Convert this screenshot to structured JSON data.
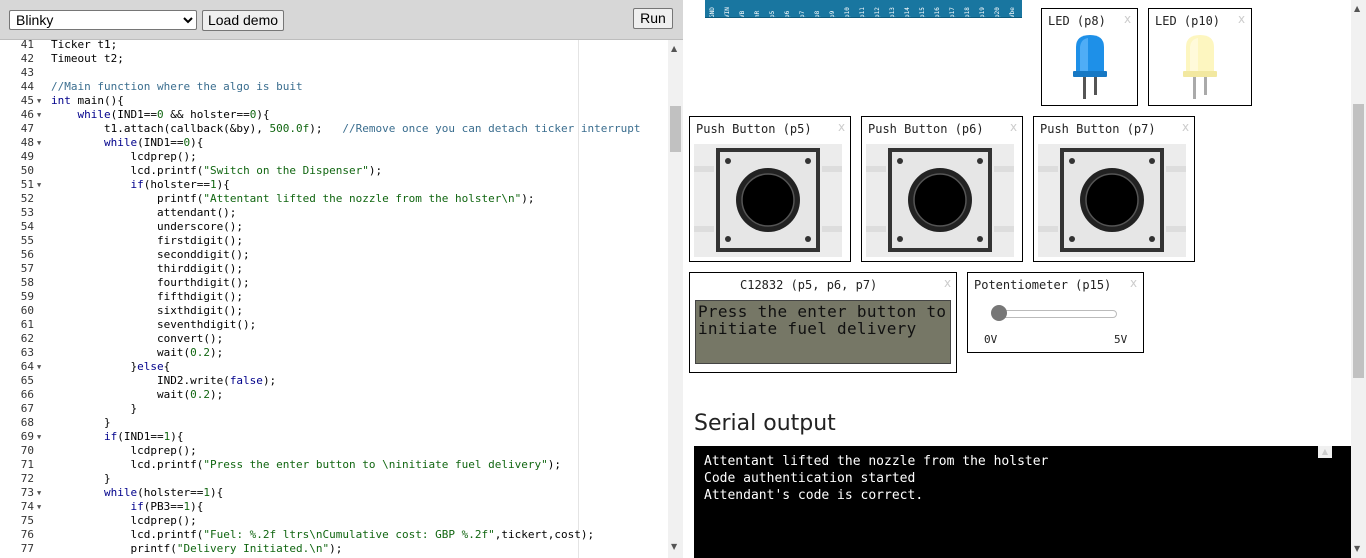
{
  "toolbar": {
    "selected_demo": "Blinky",
    "load_label": "Load demo",
    "run_label": "Run"
  },
  "editor": {
    "lines": [
      {
        "n": "41",
        "fold": false,
        "parts": [
          [
            "",
            "Ticker t1;"
          ]
        ]
      },
      {
        "n": "42",
        "fold": false,
        "parts": [
          [
            "",
            "Timeout t2;"
          ]
        ]
      },
      {
        "n": "43",
        "fold": false,
        "parts": [
          [
            "",
            ""
          ]
        ]
      },
      {
        "n": "44",
        "fold": false,
        "parts": [
          [
            "c",
            "//Main function where the algo is buit"
          ]
        ]
      },
      {
        "n": "45",
        "fold": true,
        "parts": [
          [
            "k",
            "int"
          ],
          [
            "",
            " main(){"
          ]
        ]
      },
      {
        "n": "46",
        "fold": true,
        "parts": [
          [
            "",
            "    "
          ],
          [
            "k",
            "while"
          ],
          [
            "",
            "(IND1=="
          ],
          [
            "n",
            "0"
          ],
          [
            "",
            " && holster=="
          ],
          [
            "n",
            "0"
          ],
          [
            "",
            "){"
          ]
        ]
      },
      {
        "n": "47",
        "fold": false,
        "parts": [
          [
            "",
            "        t1.attach(callback(&by), "
          ],
          [
            "n",
            "500.0f"
          ],
          [
            "",
            ");   "
          ],
          [
            "c",
            "//Remove once you can detach ticker interrupt"
          ]
        ]
      },
      {
        "n": "48",
        "fold": true,
        "parts": [
          [
            "",
            "        "
          ],
          [
            "k",
            "while"
          ],
          [
            "",
            "(IND1=="
          ],
          [
            "n",
            "0"
          ],
          [
            "",
            "){"
          ]
        ]
      },
      {
        "n": "49",
        "fold": false,
        "parts": [
          [
            "",
            "            lcdprep();"
          ]
        ]
      },
      {
        "n": "50",
        "fold": false,
        "parts": [
          [
            "",
            "            lcd.printf("
          ],
          [
            "s",
            "\"Switch on the Dispenser\""
          ],
          [
            "",
            ");"
          ]
        ]
      },
      {
        "n": "51",
        "fold": true,
        "parts": [
          [
            "",
            "            "
          ],
          [
            "k",
            "if"
          ],
          [
            "",
            "(holster=="
          ],
          [
            "n",
            "1"
          ],
          [
            "",
            "){"
          ]
        ]
      },
      {
        "n": "52",
        "fold": false,
        "parts": [
          [
            "",
            "                printf("
          ],
          [
            "s",
            "\"Attentant lifted the nozzle from the holster\\n\""
          ],
          [
            "",
            ");"
          ]
        ]
      },
      {
        "n": "53",
        "fold": false,
        "parts": [
          [
            "",
            "                attendant();"
          ]
        ]
      },
      {
        "n": "54",
        "fold": false,
        "parts": [
          [
            "",
            "                underscore();"
          ]
        ]
      },
      {
        "n": "55",
        "fold": false,
        "parts": [
          [
            "",
            "                firstdigit();"
          ]
        ]
      },
      {
        "n": "56",
        "fold": false,
        "parts": [
          [
            "",
            "                seconddigit();"
          ]
        ]
      },
      {
        "n": "57",
        "fold": false,
        "parts": [
          [
            "",
            "                thirddigit();"
          ]
        ]
      },
      {
        "n": "58",
        "fold": false,
        "parts": [
          [
            "",
            "                fourthdigit();"
          ]
        ]
      },
      {
        "n": "59",
        "fold": false,
        "parts": [
          [
            "",
            "                fifthdigit();"
          ]
        ]
      },
      {
        "n": "60",
        "fold": false,
        "parts": [
          [
            "",
            "                sixthdigit();"
          ]
        ]
      },
      {
        "n": "61",
        "fold": false,
        "parts": [
          [
            "",
            "                seventhdigit();"
          ]
        ]
      },
      {
        "n": "62",
        "fold": false,
        "parts": [
          [
            "",
            "                convert();"
          ]
        ]
      },
      {
        "n": "63",
        "fold": false,
        "parts": [
          [
            "",
            "                wait("
          ],
          [
            "n",
            "0.2"
          ],
          [
            "",
            ");"
          ]
        ]
      },
      {
        "n": "64",
        "fold": true,
        "parts": [
          [
            "",
            "            }"
          ],
          [
            "k",
            "else"
          ],
          [
            "",
            "{"
          ]
        ]
      },
      {
        "n": "65",
        "fold": false,
        "parts": [
          [
            "",
            "                IND2.write("
          ],
          [
            "k",
            "false"
          ],
          [
            "",
            ");"
          ]
        ]
      },
      {
        "n": "66",
        "fold": false,
        "parts": [
          [
            "",
            "                wait("
          ],
          [
            "n",
            "0.2"
          ],
          [
            "",
            ");"
          ]
        ]
      },
      {
        "n": "67",
        "fold": false,
        "parts": [
          [
            "",
            "            }"
          ]
        ]
      },
      {
        "n": "68",
        "fold": false,
        "parts": [
          [
            "",
            "        }"
          ]
        ]
      },
      {
        "n": "69",
        "fold": true,
        "parts": [
          [
            "",
            "        "
          ],
          [
            "k",
            "if"
          ],
          [
            "",
            "(IND1=="
          ],
          [
            "n",
            "1"
          ],
          [
            "",
            "){"
          ]
        ]
      },
      {
        "n": "70",
        "fold": false,
        "parts": [
          [
            "",
            "            lcdprep();"
          ]
        ]
      },
      {
        "n": "71",
        "fold": false,
        "parts": [
          [
            "",
            "            lcd.printf("
          ],
          [
            "s",
            "\"Press the enter button to \\ninitiate fuel delivery\""
          ],
          [
            "",
            ");"
          ]
        ]
      },
      {
        "n": "72",
        "fold": false,
        "parts": [
          [
            "",
            "        }"
          ]
        ]
      },
      {
        "n": "73",
        "fold": true,
        "parts": [
          [
            "",
            "        "
          ],
          [
            "k",
            "while"
          ],
          [
            "",
            "(holster=="
          ],
          [
            "n",
            "1"
          ],
          [
            "",
            "){"
          ]
        ]
      },
      {
        "n": "74",
        "fold": true,
        "parts": [
          [
            "",
            "            "
          ],
          [
            "k",
            "if"
          ],
          [
            "",
            "(PB3=="
          ],
          [
            "n",
            "1"
          ],
          [
            "",
            "){"
          ]
        ]
      },
      {
        "n": "75",
        "fold": false,
        "parts": [
          [
            "",
            "            lcdprep();"
          ]
        ]
      },
      {
        "n": "76",
        "fold": false,
        "parts": [
          [
            "",
            "            lcd.printf("
          ],
          [
            "s",
            "\"Fuel: %.2f ltrs\\nCumulative cost: GBP %.2f\""
          ],
          [
            "",
            ",tickert,cost);"
          ]
        ]
      },
      {
        "n": "77",
        "fold": false,
        "parts": [
          [
            "",
            "            printf("
          ],
          [
            "s",
            "\"Delivery Initiated.\\n\""
          ],
          [
            "",
            ");"
          ]
        ]
      }
    ]
  },
  "board": {
    "pins": [
      "GND",
      "VIN",
      "VB",
      "nR",
      "p5",
      "p6",
      "p7",
      "p8",
      "p9",
      "p10",
      "p11",
      "p12",
      "p13",
      "p14",
      "p15",
      "p16",
      "p17",
      "p18",
      "p19",
      "p20",
      "Vbe"
    ]
  },
  "leds": [
    {
      "title": "LED (p8)",
      "color": "blue",
      "hex": "#1e90e8"
    },
    {
      "title": "LED (p10)",
      "color": "yellow",
      "hex": "#fdf6c0"
    }
  ],
  "buttons": [
    {
      "title": "Push Button (p5)"
    },
    {
      "title": "Push Button (p6)"
    },
    {
      "title": "Push Button (p7)"
    }
  ],
  "lcd": {
    "title": "C12832 (p5, p6, p7)",
    "line1": "Press the enter button to",
    "line2": "initiate fuel delivery"
  },
  "pot": {
    "title": "Potentiometer (p15)",
    "min_label": "0V",
    "max_label": "5V",
    "level": 0.0
  },
  "serial": {
    "title": "Serial output",
    "lines": [
      "Attentant lifted the nozzle from the holster",
      "Code authentication started",
      "Attendant's code is correct."
    ]
  },
  "close_glyph": "x"
}
